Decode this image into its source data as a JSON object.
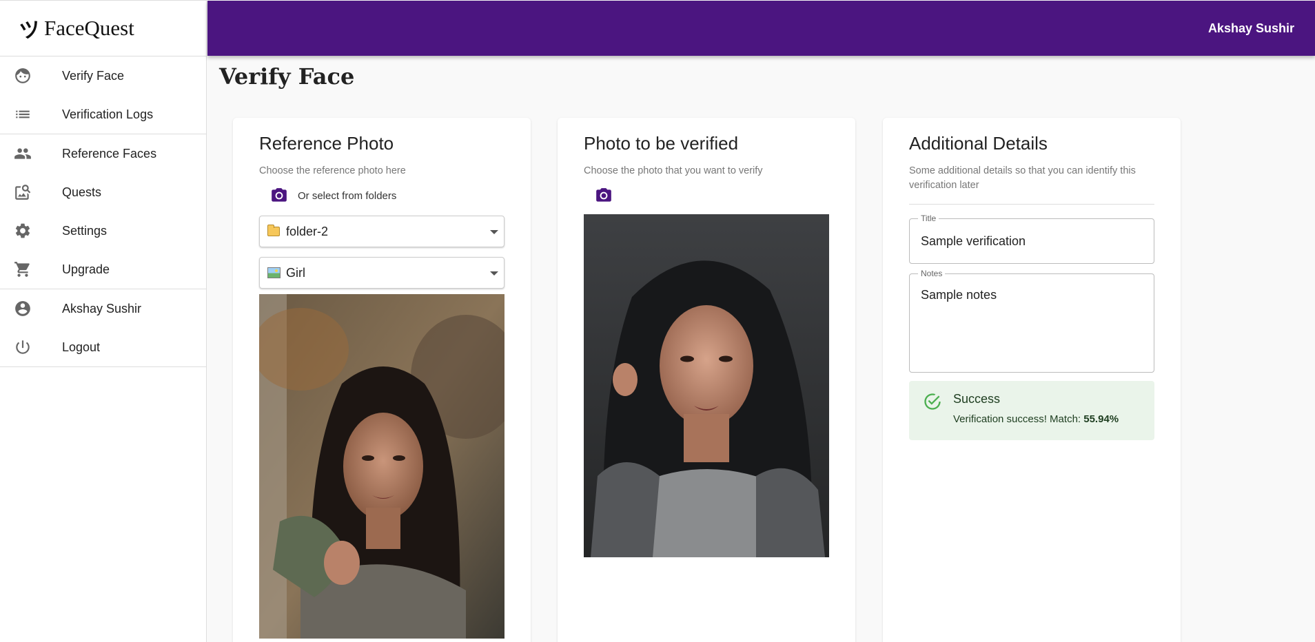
{
  "app": {
    "name": "FaceQuest",
    "logo_mark": "ツ"
  },
  "header": {
    "user_name": "Akshay Sushir"
  },
  "sidebar": {
    "items": [
      {
        "label": "Verify Face",
        "icon": "face-icon"
      },
      {
        "label": "Verification Logs",
        "icon": "list-icon"
      },
      {
        "label": "Reference Faces",
        "icon": "people-icon"
      },
      {
        "label": "Quests",
        "icon": "image-search-icon"
      },
      {
        "label": "Settings",
        "icon": "gear-icon"
      },
      {
        "label": "Upgrade",
        "icon": "cart-icon"
      },
      {
        "label": "Akshay Sushir",
        "icon": "account-circle-icon"
      },
      {
        "label": "Logout",
        "icon": "power-icon"
      }
    ]
  },
  "page": {
    "title": "Verify Face"
  },
  "reference": {
    "title": "Reference Photo",
    "subtitle": "Choose the reference photo here",
    "folder_prompt": "Or select from folders",
    "folder_value": "folder-2",
    "image_value": "Girl"
  },
  "verify": {
    "title": "Photo to be verified",
    "subtitle": "Choose the photo that you want to verify"
  },
  "details": {
    "title": "Additional Details",
    "subtitle": "Some additional details so that you can identify this verification later",
    "title_label": "Title",
    "title_value": "Sample verification",
    "notes_label": "Notes",
    "notes_value": "Sample notes"
  },
  "result": {
    "title": "Success",
    "message": "Verification success! Match: ",
    "match": "55.94%",
    "status_color": "#4caf50"
  },
  "colors": {
    "brand": "#4b1580"
  }
}
